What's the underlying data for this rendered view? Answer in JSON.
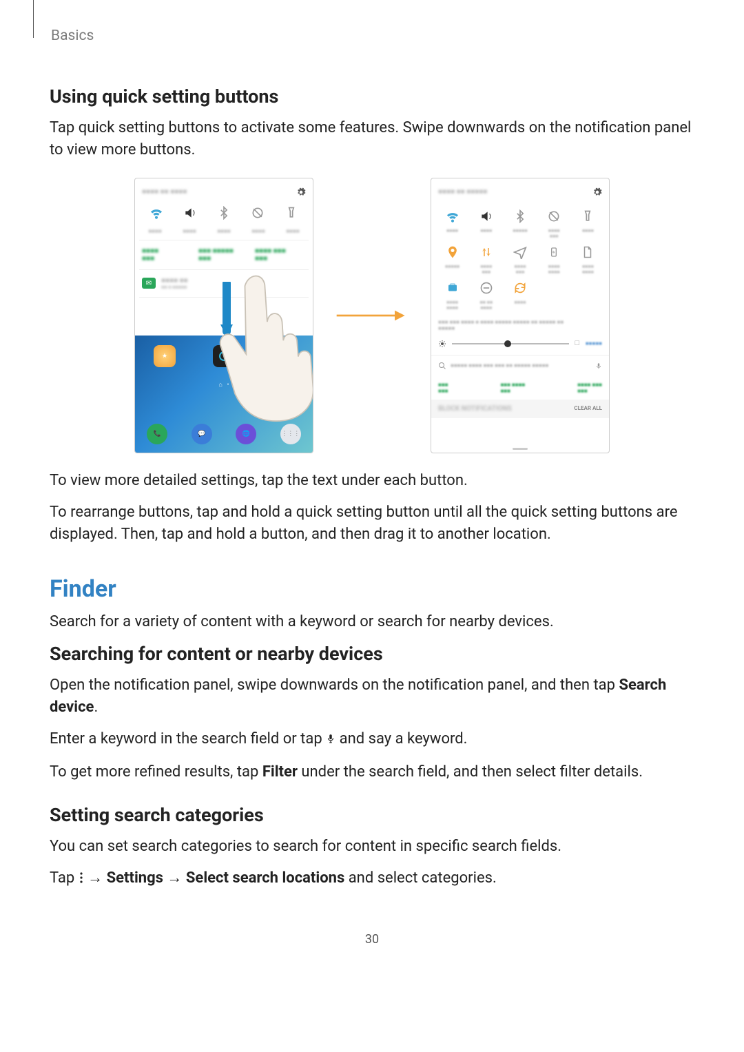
{
  "running_head": "Basics",
  "h_quick": "Using quick setting buttons",
  "p_quick": "Tap quick setting buttons to activate some features. Swipe downwards on the notification panel to view more buttons.",
  "p_after1": "To view more detailed settings, tap the text under each button.",
  "p_after2": "To rearrange buttons, tap and hold a quick setting button until all the quick setting buttons are displayed. Then, tap and hold a button, and then drag it to another location.",
  "h_finder": "Finder",
  "p_finder_intro": "Search for a variety of content with a keyword or search for nearby devices.",
  "h_search": "Searching for content or nearby devices",
  "p_search_1a": "Open the notification panel, swipe downwards on the notification panel, and then tap ",
  "p_search_1b": "Search device",
  "p_search_1c": ".",
  "p_search_2a": "Enter a keyword in the search field or tap ",
  "p_search_2b": " and say a keyword.",
  "p_search_3a": "To get more refined results, tap ",
  "p_search_3b": "Filter",
  "p_search_3c": " under the search field, and then select filter details.",
  "h_cat": "Setting search categories",
  "p_cat_1": "You can set search categories to search for content in specific search fields.",
  "tap_prefix": "Tap ",
  "arrow": " → ",
  "tap_settings": "Settings",
  "tap_select": "Select search locations",
  "tap_suffix": " and select categories.",
  "page_num": "30",
  "fig": {
    "clear_all": "CLEAR ALL",
    "block": "BLOCK NOTIFICATIONS"
  }
}
